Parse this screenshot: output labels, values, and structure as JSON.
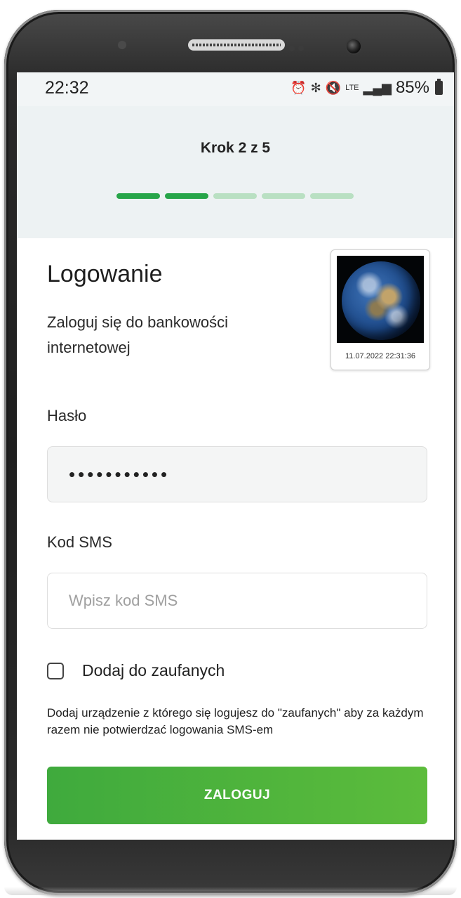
{
  "status_bar": {
    "time": "22:32",
    "icons": [
      "alarm-icon",
      "bluetooth-icon",
      "mute-icon",
      "lte-icon",
      "signal-icon"
    ],
    "lte_label": "LTE",
    "battery_text": "85%"
  },
  "header": {
    "step_title": "Krok 2 z 5",
    "progress": {
      "total": 5,
      "completed": 2
    }
  },
  "login": {
    "title": "Logowanie",
    "subtitle": "Zaloguj się do bankowości internetowej",
    "security_image_date": "11.07.2022 22:31:36"
  },
  "form": {
    "password_label": "Hasło",
    "password_value": "•••••••••••",
    "sms_label": "Kod SMS",
    "sms_placeholder": "Wpisz kod SMS",
    "trusted_label": "Dodaj do zaufanych",
    "trusted_checked": false,
    "trusted_info": "Dodaj urządzenie z którego się logujesz do \"zaufanych\" aby za każdym razem nie potwierdzać logowania SMS-em",
    "submit_label": "ZALOGUJ"
  },
  "colors": {
    "accent_green": "#27a549",
    "progress_inactive": "#b9e0c2",
    "header_bg": "#edf2f3"
  }
}
